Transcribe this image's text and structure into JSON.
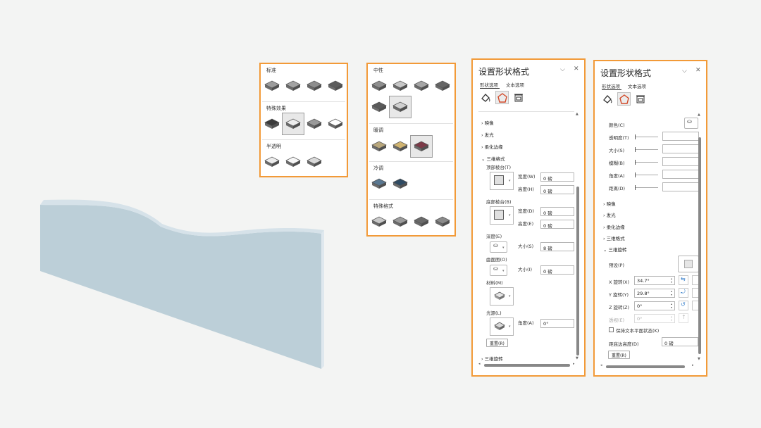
{
  "colors": {
    "accent": "#f29a38",
    "wave_face": "#bccfd8",
    "wave_top": "#d6e2e9"
  },
  "bevel_gallery": {
    "groups": [
      {
        "label": "标准",
        "items": [
          "#9c9c9c",
          "#a3a3a3",
          "#8e8e8e",
          "#5c5c5c"
        ],
        "selected": -1
      },
      {
        "label": "特殊效果",
        "items": [
          "#3b3b3b",
          "#ededed",
          "#9a9a9a",
          "#ffffff"
        ],
        "selected": 1
      },
      {
        "label": "半透明",
        "items": [
          "#ececec",
          "#f7f7f7",
          "#d9d9d9"
        ],
        "selected": -1
      }
    ]
  },
  "material_gallery": {
    "groups": [
      {
        "label": "中性",
        "items": [
          "#8f8f8f",
          "#c7c7c7",
          "#a5a5a5",
          "#666666",
          "#5a5a5a",
          "#d0d0d0"
        ],
        "selected": 5
      },
      {
        "label": "暖调",
        "items": [
          "#b9a77c",
          "#d1b470",
          "#7d3a48"
        ],
        "selected": 2
      },
      {
        "label": "冷调",
        "items": [
          "#5a7891",
          "#2f4b63"
        ],
        "selected": -1
      },
      {
        "label": "特殊格式",
        "items": [
          "#c8c8c8",
          "#9b9b9b",
          "#6a6a6a",
          "#8a8a8a"
        ],
        "selected": -1
      }
    ]
  },
  "format_pane_1": {
    "title": "设置形状格式",
    "tabs": [
      "形状选项",
      "文本选项"
    ],
    "sections": {
      "reflection": "映像",
      "glow": "发光",
      "soft_edges": "柔化边缘",
      "format3d": "三维格式",
      "rotation3d": "三维旋转"
    },
    "top_bevel": {
      "label": "顶部棱台(T)",
      "width_label": "宽度(W)",
      "width": "0 磅",
      "height_label": "高度(H)",
      "height": "0 磅"
    },
    "bottom_bevel": {
      "label": "底部棱台(B)",
      "width_label": "宽度(D)",
      "width": "0 磅",
      "height_label": "高度(E)",
      "height": "0 磅"
    },
    "depth": {
      "label": "深度(E)",
      "size_label": "大小(S)",
      "size": "8 磅"
    },
    "contour": {
      "label": "曲面图(O)",
      "size_label": "大小(I)",
      "size": "0 磅"
    },
    "material_label": "材料(M)",
    "lighting": {
      "label": "光源(L)",
      "angle_label": "角度(A)",
      "angle": "0°"
    },
    "reset": "重置(R)"
  },
  "format_pane_2": {
    "title": "设置形状格式",
    "tabs": [
      "形状选项",
      "文本选项"
    ],
    "shadow_rows": [
      "颜色(C)",
      "透明度(T)",
      "大小(S)",
      "模糊(B)",
      "角度(A)",
      "距离(D)"
    ],
    "sections": [
      "映像",
      "发光",
      "柔化边缘",
      "三维格式",
      "三维旋转"
    ],
    "preset_label": "预设(P)",
    "rotations": [
      {
        "label": "X 旋转(X)",
        "value": "34.7°",
        "enabled": true
      },
      {
        "label": "Y 旋转(Y)",
        "value": "29.8°",
        "enabled": true
      },
      {
        "label": "Z 旋转(Z)",
        "value": "0°",
        "enabled": true
      },
      {
        "label": "透视(E)",
        "value": "0°",
        "enabled": false
      }
    ],
    "keep_text_flat": "保持文本平面状态(K)",
    "distance_label": "距底边高度(D)",
    "distance_value": "0 磅",
    "reset": "重置(R)"
  }
}
